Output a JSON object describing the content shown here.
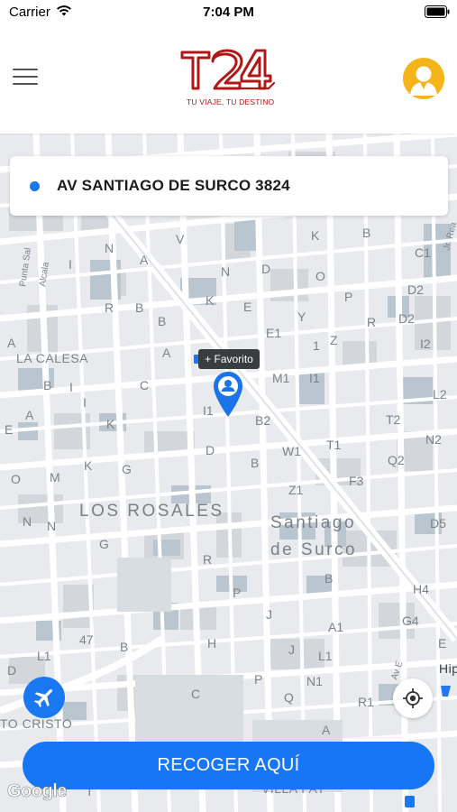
{
  "status_bar": {
    "carrier": "Carrier",
    "time": "7:04 PM",
    "wifi_icon": "wifi-icon",
    "battery_icon": "battery-icon"
  },
  "header": {
    "menu_icon": "hamburger-menu-icon",
    "logo_text": "T24",
    "tagline": "TU VIAJE, TU DESTINO",
    "avatar_icon": "user-avatar-icon"
  },
  "address": {
    "text": "AV SANTIAGO DE SURCO 3824"
  },
  "map": {
    "favorite_label": "+ Favorito",
    "labels": [
      {
        "text": "LA CALESA",
        "size": "normal"
      },
      {
        "text": "LOS ROSALES",
        "size": "big"
      },
      {
        "text": "Santiago",
        "size": "big"
      },
      {
        "text": "de Surco",
        "size": "big"
      },
      {
        "text": "TO CRISTO",
        "size": "normal"
      },
      {
        "text": "VILLA FAY",
        "size": "normal"
      },
      {
        "text": "Hip",
        "size": "normal"
      }
    ],
    "google_logo": "Google"
  },
  "actions": {
    "airport_icon": "airplane-icon",
    "locate_icon": "my-location-icon",
    "pickup_label": "RECOGER AQUÍ"
  },
  "colors": {
    "primary": "#1676f3",
    "brand_red": "#b01818",
    "avatar_bg": "#f5b51a"
  }
}
